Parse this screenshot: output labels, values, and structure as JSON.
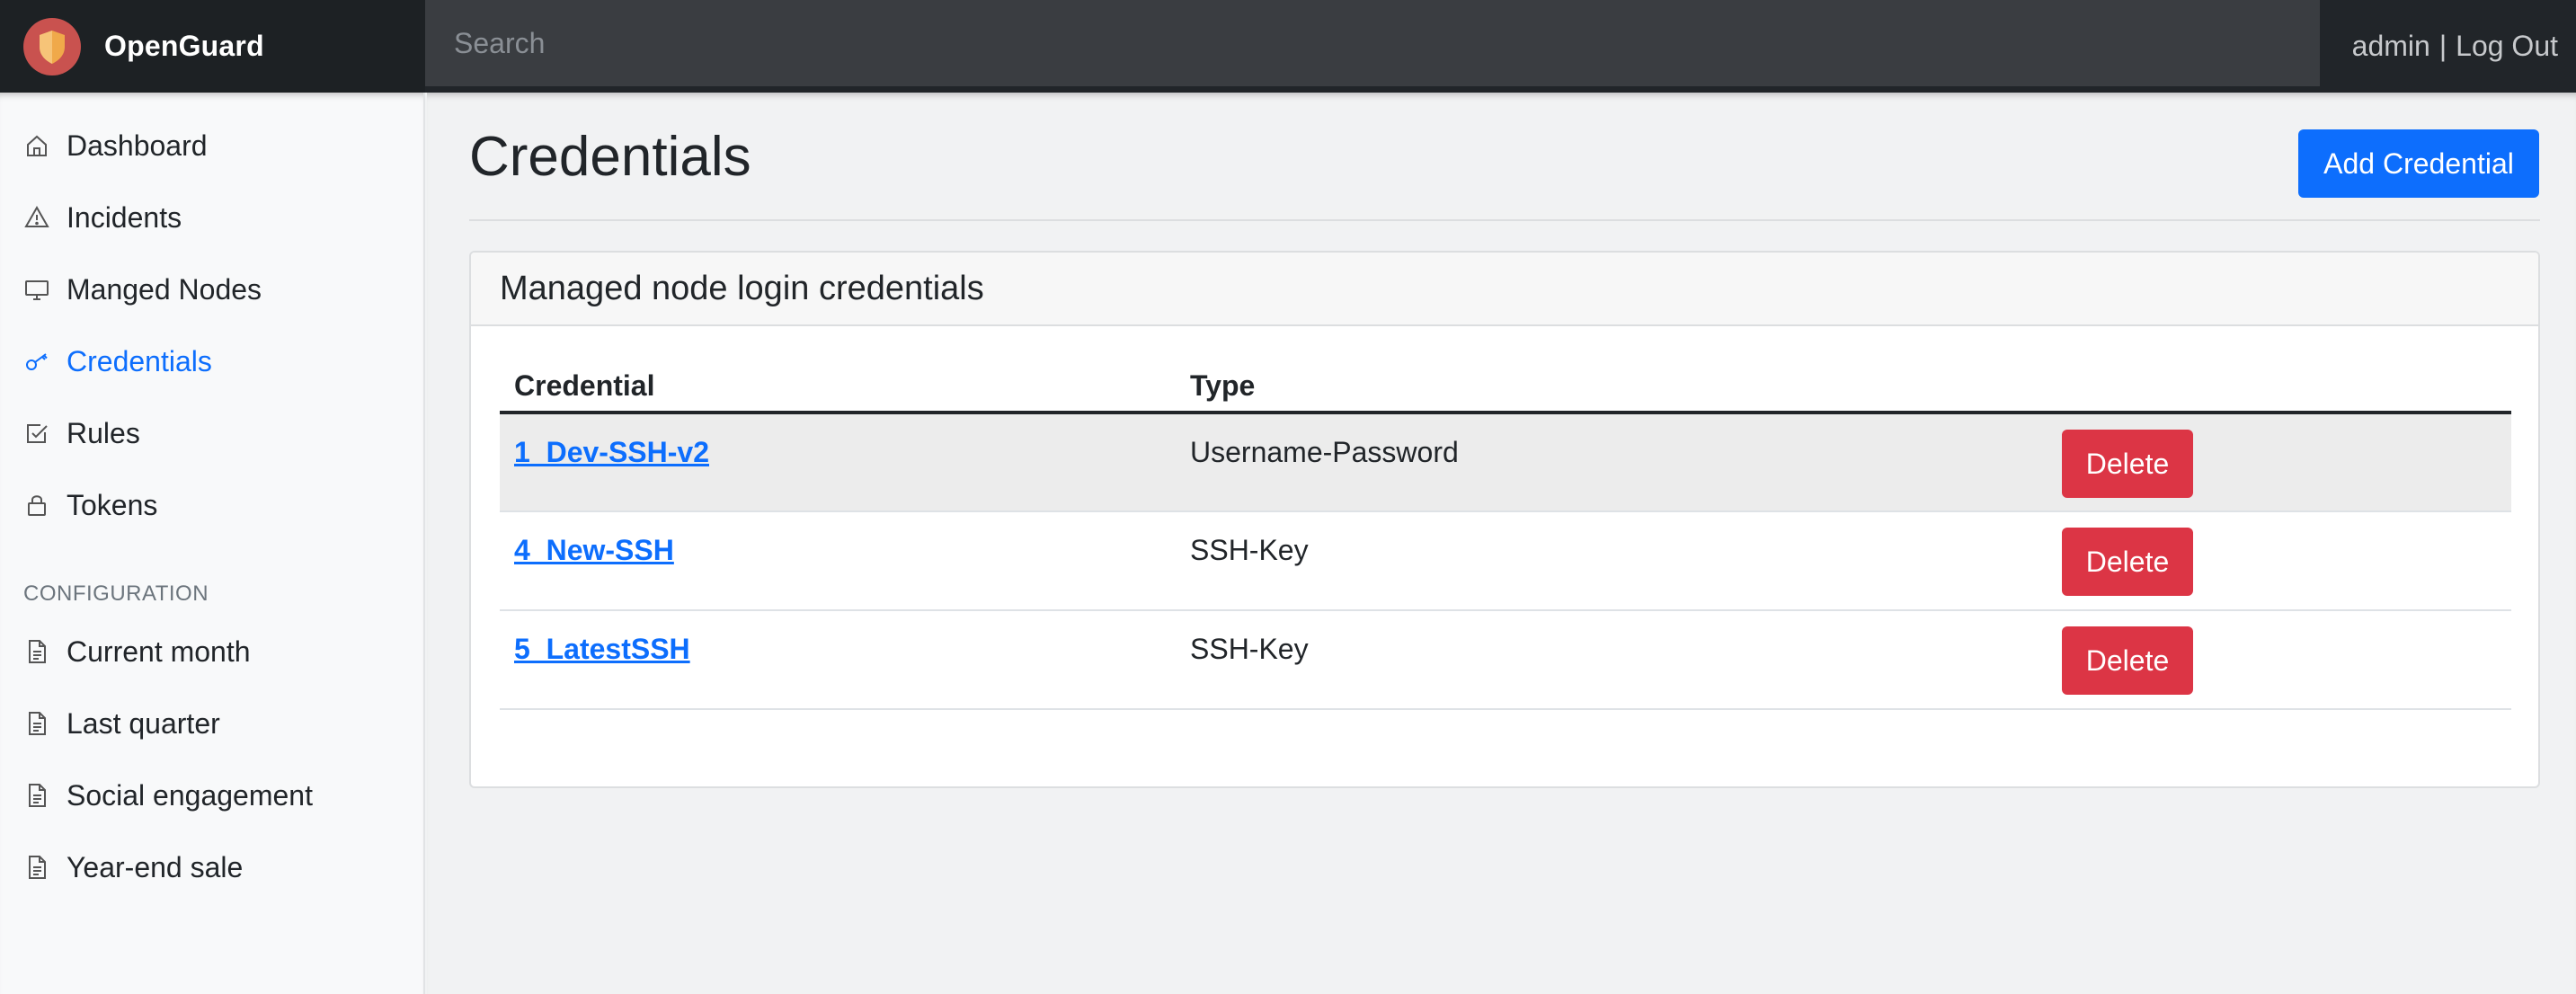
{
  "brand": {
    "name": "OpenGuard",
    "logo_icon": "shield-icon"
  },
  "search": {
    "placeholder": "Search",
    "value": ""
  },
  "user": {
    "username": "admin",
    "separator": "|",
    "logout_label": "Log Out"
  },
  "sidebar": {
    "items": [
      {
        "label": "Dashboard",
        "icon": "home-icon",
        "active": false
      },
      {
        "label": "Incidents",
        "icon": "warning-icon",
        "active": false
      },
      {
        "label": "Manged Nodes",
        "icon": "monitor-icon",
        "active": false
      },
      {
        "label": "Credentials",
        "icon": "key-icon",
        "active": true
      },
      {
        "label": "Rules",
        "icon": "checkbox-icon",
        "active": false
      },
      {
        "label": "Tokens",
        "icon": "lock-icon",
        "active": false
      }
    ],
    "section_heading": "CONFIGURATION",
    "config_items": [
      {
        "label": "Current month",
        "icon": "document-icon"
      },
      {
        "label": "Last quarter",
        "icon": "document-icon"
      },
      {
        "label": "Social engagement",
        "icon": "document-icon"
      },
      {
        "label": "Year-end sale",
        "icon": "document-icon"
      }
    ]
  },
  "main": {
    "title": "Credentials",
    "add_button_label": "Add Credential",
    "card_title": "Managed node login credentials",
    "table": {
      "columns": [
        "Credential",
        "Type",
        ""
      ],
      "rows": [
        {
          "credential": "1_Dev-SSH-v2",
          "type": "Username-Password",
          "action": "Delete"
        },
        {
          "credential": "4_New-SSH",
          "type": "SSH-Key",
          "action": "Delete"
        },
        {
          "credential": "5_LatestSSH",
          "type": "SSH-Key",
          "action": "Delete"
        }
      ]
    }
  },
  "colors": {
    "navbar_bg": "#212529",
    "primary": "#0d6efd",
    "danger": "#dc3545",
    "active_nav": "#0d6efd",
    "logo_circle": "#c9524f",
    "logo_shield": "#f0a94a"
  }
}
